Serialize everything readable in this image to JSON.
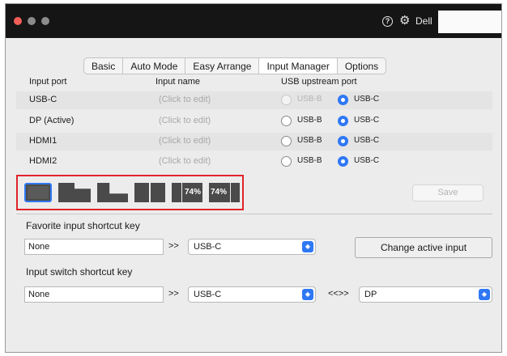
{
  "window": {
    "brand": "Dell"
  },
  "tabs": [
    {
      "label": "Basic",
      "active": false
    },
    {
      "label": "Auto Mode",
      "active": false
    },
    {
      "label": "Easy Arrange",
      "active": false
    },
    {
      "label": "Input Manager",
      "active": true
    },
    {
      "label": "Options",
      "active": false
    }
  ],
  "table": {
    "headers": {
      "port": "Input port",
      "name": "Input name",
      "usb": "USB upstream port"
    },
    "rows": [
      {
        "port": "USB-C",
        "name": "(Click to edit)",
        "usb_b": "USB-B",
        "usb_c": "USB-C",
        "selected": "USB-C",
        "usb_b_disabled": true
      },
      {
        "port": "DP (Active)",
        "name": "(Click to edit)",
        "usb_b": "USB-B",
        "usb_c": "USB-C",
        "selected": "USB-C",
        "usb_b_disabled": false
      },
      {
        "port": "HDMI1",
        "name": "(Click to edit)",
        "usb_b": "USB-B",
        "usb_c": "USB-C",
        "selected": "USB-C",
        "usb_b_disabled": false
      },
      {
        "port": "HDMI2",
        "name": "(Click to edit)",
        "usb_b": "USB-B",
        "usb_c": "USB-C",
        "selected": "USB-C",
        "usb_b_disabled": false
      }
    ]
  },
  "layouts": {
    "selected_index": 0,
    "pip_a_label": "74%",
    "pip_b_label": "74%",
    "selected_color": "#2f78f5"
  },
  "save_label": "Save",
  "favorite": {
    "label": "Favorite input shortcut key",
    "key_value": "None",
    "arrows": ">>",
    "select_value": "USB-C",
    "change_button": "Change active input"
  },
  "switch": {
    "label": "Input switch shortcut key",
    "key_value": "None",
    "arrows": ">>",
    "select_a": "USB-C",
    "swap_arrows": "<<>>",
    "select_b": "DP"
  },
  "colors": {
    "accent": "#2f78f5",
    "highlight_border": "#e0242b",
    "titlebar": "#151515"
  },
  "icons": {
    "help": "help-circle-icon",
    "settings": "gear-icon"
  }
}
